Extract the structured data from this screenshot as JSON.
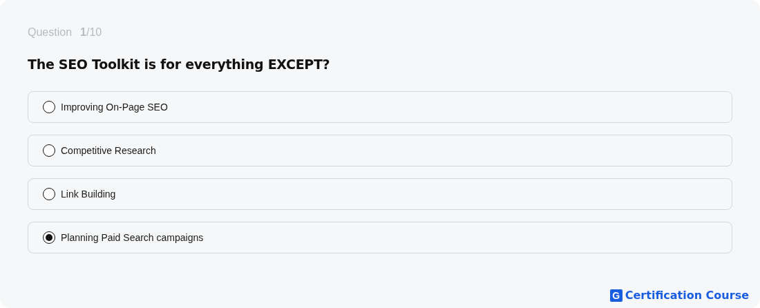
{
  "header": {
    "label": "Question",
    "counter": "**1**/10"
  },
  "question": "The SEO Toolkit is for everything EXCEPT?",
  "options": [
    {
      "label": "Improving On-Page SEO",
      "selected": false
    },
    {
      "label": "Competitive Research",
      "selected": false
    },
    {
      "label": "Link Building",
      "selected": false
    },
    {
      "label": "Planning Paid Search campaigns",
      "selected": true
    }
  ],
  "footer": {
    "logo_mark": "G",
    "title": "Certification Course"
  }
}
